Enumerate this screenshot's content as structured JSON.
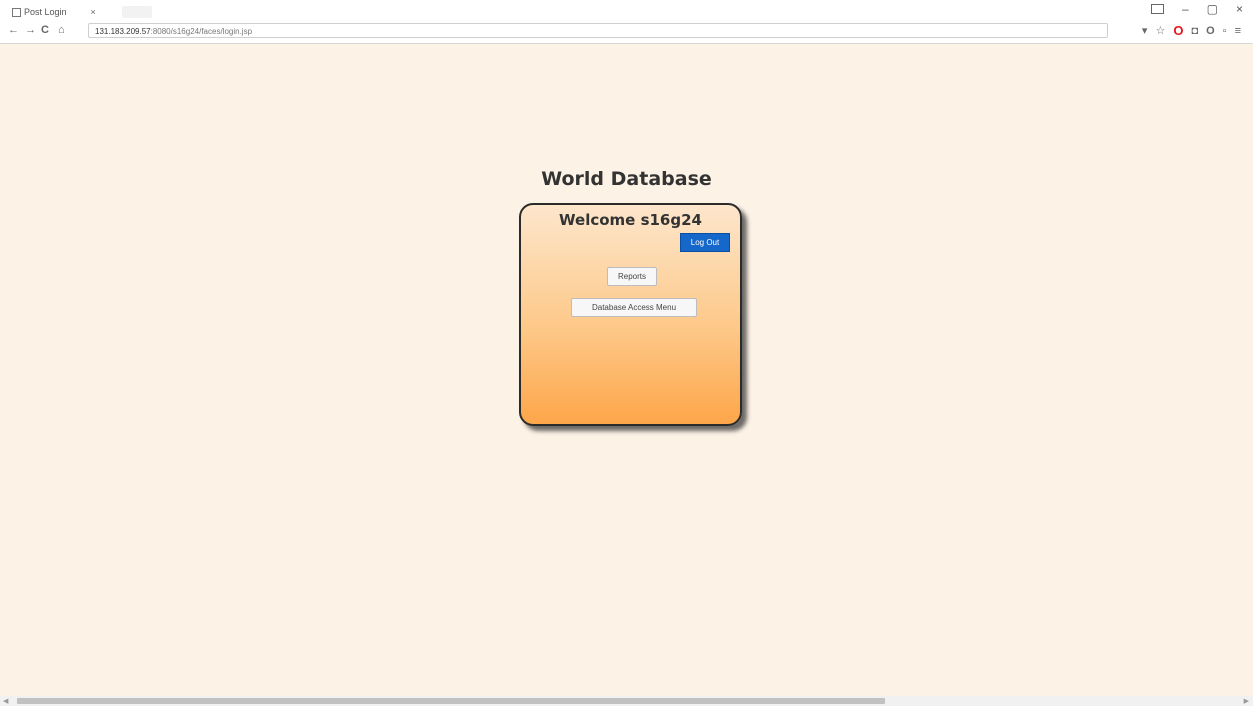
{
  "browser": {
    "tab_title": "Post Login",
    "tab_close": "×",
    "url_host": "131.183.209.57",
    "url_path": ":8080/s16g24/faces/login.jsp",
    "window_controls": {
      "minimize": "–",
      "maximize": "▢",
      "close": "×"
    },
    "nav": {
      "back": "←",
      "forward": "→",
      "reload": "C",
      "home": "⌂"
    },
    "extensions": [
      "funnel-icon",
      "star-icon",
      "opera-icon",
      "pocket-icon",
      "circle-icon",
      "menu-icon"
    ]
  },
  "page": {
    "heading": "World Database",
    "welcome": "Welcome s16g24",
    "logout_label": "Log Out",
    "reports_label": "Reports",
    "db_menu_label": "Database Access Menu"
  },
  "colors": {
    "page_background": "#fdf2e6",
    "card_top": "#fde6cc",
    "card_bottom": "#fda64a",
    "logout_button": "#1567c9"
  }
}
